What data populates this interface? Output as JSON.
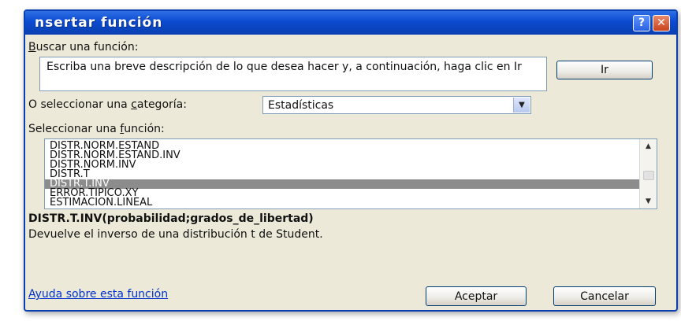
{
  "dialog": {
    "title": "nsertar función",
    "help_button": "?",
    "close_button": "✕"
  },
  "search": {
    "label": "uscar una función:",
    "label_hotkey": "B",
    "value": "Escriba una breve descripción de lo que desea hacer y, a continuación, haga clic en Ir",
    "go_button": "Ir"
  },
  "category": {
    "label_before": "O seleccionar una ",
    "label_hotkey": "c",
    "label_after": "ategoría:",
    "value": "Estadísticas"
  },
  "function_list": {
    "label_before": "Seleccionar una ",
    "label_hotkey": "f",
    "label_after": "unción:",
    "items": [
      "DISTR.NORM.ESTAND",
      "DISTR.NORM.ESTAND.INV",
      "DISTR.NORM.INV",
      "DISTR.T",
      "DISTR.T.INV",
      "ERROR.TIPICO.XY",
      "ESTIMACION.LINEAL"
    ],
    "selected_index": 4
  },
  "details": {
    "signature": "DISTR.T.INV(probabilidad;grados_de_libertad)",
    "description": "Devuelve el inverso de una distribución t de Student."
  },
  "footer": {
    "help_link": "Ayuda sobre esta función",
    "ok_button": "Aceptar",
    "cancel_button": "Cancelar"
  },
  "icons": {
    "up_arrow": "▲",
    "down_arrow": "▼"
  }
}
